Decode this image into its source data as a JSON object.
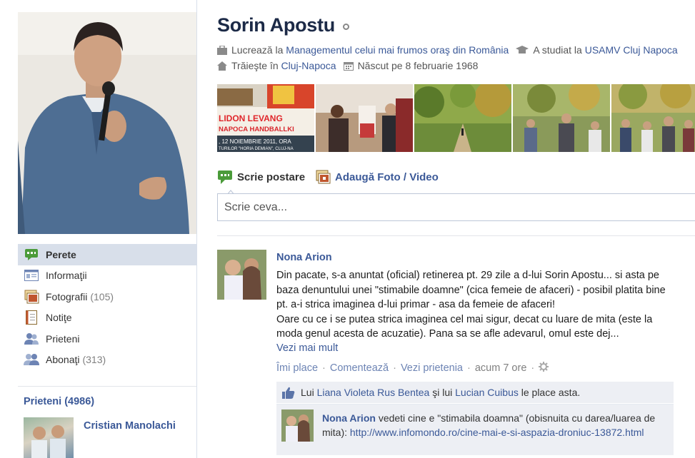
{
  "profile": {
    "name": "Sorin Apostu",
    "info": {
      "works_prefix": "Lucrează la",
      "works_link": "Managementul celui mai frumos oraş din România",
      "studied_prefix": "A studiat la",
      "studied_link": "USAMV Cluj Napoca",
      "lives_prefix": "Trăieşte în",
      "lives_link": "Cluj-Napoca",
      "born": "Născut pe 8 februarie 1968"
    }
  },
  "sidebar": {
    "items": [
      {
        "label": "Perete",
        "count": "",
        "icon": "wall-icon"
      },
      {
        "label": "Informaţii",
        "count": "",
        "icon": "info-card-icon"
      },
      {
        "label": "Fotografii",
        "count": "(105)",
        "icon": "photos-icon"
      },
      {
        "label": "Notiţe",
        "count": "",
        "icon": "notes-icon"
      },
      {
        "label": "Prieteni",
        "count": "",
        "icon": "friends-icon"
      },
      {
        "label": "Abonaţi",
        "count": "(313)",
        "icon": "subscribers-icon"
      }
    ]
  },
  "friends": {
    "title": "Prieteni (4986)",
    "first_name": "Cristian Manolachi"
  },
  "photo_strip": {
    "poster_line1": "LIDON  LEVANG",
    "poster_line2": "NAPOCA  HANDBALLKI",
    "poster_line3": ", 12 NOIEMBRIE 2011, ORA",
    "poster_line4": "TURILOR \"HORIA DEMIAN\", CLUJ-NA"
  },
  "composer": {
    "write_label": "Scrie postare",
    "photo_label": "Adaugă Foto / Video",
    "placeholder": "Scrie ceva..."
  },
  "story": {
    "author": "Nona Arion",
    "text_line1": "Din pacate, s-a anuntat (oficial) retinerea pt. 29 zile a d-lui Sorin Apostu... si asta pe baza denuntului unei \"stimabile doamne\" (cica femeie de afaceri) - posibil platita bine pt. a-i strica imaginea d-lui primar - asa da femeie de afaceri!",
    "text_line2": "Oare cu ce i se putea strica imaginea cel mai sigur, decat cu luare de mita (este la moda genul acesta de acuzatie). Pana sa se afle adevarul, omul este dej...",
    "see_more": "Vezi mai mult",
    "actions": {
      "like": "Îmi place",
      "comment": "Comentează",
      "friendship": "Vezi prietenia",
      "time": "acum 7 ore"
    },
    "likes": {
      "prefix": "Lui",
      "person1": "Liana Violeta Rus Bentea",
      "connector": "şi lui",
      "person2": "Lucian Cuibus",
      "suffix": "le place asta."
    },
    "comment": {
      "author": "Nona Arion",
      "text": "vedeti cine e \"stimabila doamna\" (obisnuita cu darea/luarea de mita):",
      "link": "http://www.infomondo.ro/cine-mai-e-si-aspazia-droniuc-13872.html"
    }
  },
  "colors": {
    "link": "#3b5998",
    "name": "#1c2a47",
    "nav_active_bg": "#d8dfea",
    "ufi_bg": "#edeff4"
  }
}
